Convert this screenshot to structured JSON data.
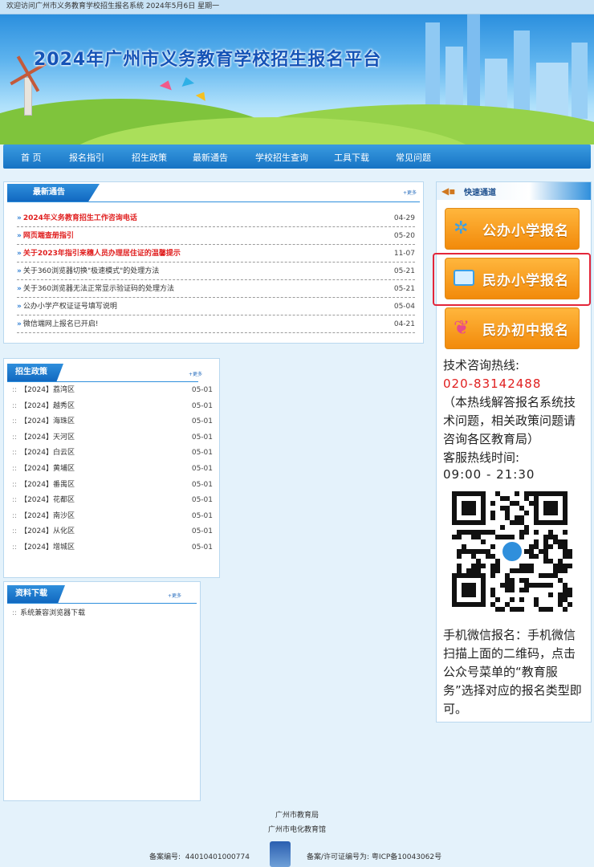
{
  "topbar": {
    "text": "欢迎访问广州市义务教育学校招生报名系统 2024年5月6日 星期一"
  },
  "banner": {
    "title": "2024年广州市义务教育学校招生报名平台"
  },
  "nav": {
    "items": [
      "首 页",
      "报名指引",
      "招生政策",
      "最新通告",
      "学校招生查询",
      "工具下载",
      "常见问题"
    ]
  },
  "notices": {
    "tab": "最新通告",
    "more": "+更多",
    "items": [
      {
        "text": "2024年义务教育招生工作咨询电话",
        "date": "04-29",
        "hot": true
      },
      {
        "text": "网页端查册指引",
        "date": "05-20",
        "hot": true
      },
      {
        "text": "关于2023年指引来穗人员办理居住证的温馨提示",
        "date": "11-07",
        "hot": true
      },
      {
        "text": "关于360浏览器切换\"极速模式\"的处理方法",
        "date": "05-21",
        "hot": false
      },
      {
        "text": "关于360浏览器无法正常显示验证码的处理方法",
        "date": "05-21",
        "hot": false
      },
      {
        "text": "公办小学产权证证号填写说明",
        "date": "05-04",
        "hot": false
      },
      {
        "text": "微信端网上报名已开启!",
        "date": "04-21",
        "hot": false
      }
    ]
  },
  "policy": {
    "tab": "招生政策",
    "more": "+更多",
    "items": [
      {
        "text": "【2024】荔湾区",
        "date": "05-01"
      },
      {
        "text": "【2024】越秀区",
        "date": "05-01"
      },
      {
        "text": "【2024】海珠区",
        "date": "05-01"
      },
      {
        "text": "【2024】天河区",
        "date": "05-01"
      },
      {
        "text": "【2024】白云区",
        "date": "05-01"
      },
      {
        "text": "【2024】黄埔区",
        "date": "05-01"
      },
      {
        "text": "【2024】番禺区",
        "date": "05-01"
      },
      {
        "text": "【2024】花都区",
        "date": "05-01"
      },
      {
        "text": "【2024】南沙区",
        "date": "05-01"
      },
      {
        "text": "【2024】从化区",
        "date": "05-01"
      },
      {
        "text": "【2024】增城区",
        "date": "05-01"
      }
    ]
  },
  "download": {
    "tab": "资料下载",
    "more": "+更多",
    "items": [
      {
        "text": "系统兼容浏览器下载"
      }
    ]
  },
  "quick": {
    "tab": "快速通道",
    "buttons": [
      "公办小学报名",
      "民办小学报名",
      "民办初中报名"
    ],
    "hotline_label": "技术咨询热线:",
    "hotline": "020-83142488",
    "hotline_note": "（本热线解答报名系统技术问题，相关政策问题请咨询各区教育局）",
    "service_label": "客服热线时间:",
    "service_time": "09:00 - 21:30",
    "wechat_note": "手机微信报名：手机微信扫描上面的二维码，点击公众号菜单的“教育服务”选择对应的报名类型即可。"
  },
  "footer": {
    "line1": "广州市教育局",
    "line2": "广州市电化教育馆",
    "record_label": "备案编号:",
    "record_no": "44010401000774",
    "icp": "备案/许可证编号为: 粤ICP备10043062号"
  },
  "colors": {
    "nav": "#1673c4",
    "accent_red": "#e01e1e",
    "button_orange": "#f28a0b",
    "highlight_border": "#e3263a"
  }
}
